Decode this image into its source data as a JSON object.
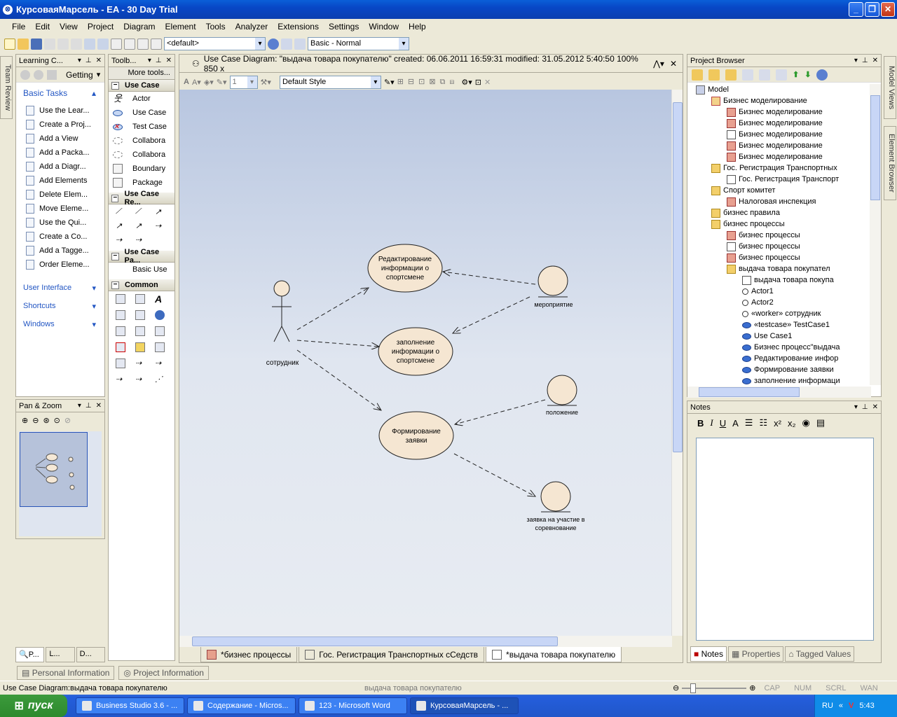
{
  "window": {
    "title": "КурсоваяМарсель - EA - 30 Day Trial"
  },
  "menu": [
    "File",
    "Edit",
    "View",
    "Project",
    "Diagram",
    "Element",
    "Tools",
    "Analyzer",
    "Extensions",
    "Settings",
    "Window",
    "Help"
  ],
  "toolbar": {
    "perspective": "<default>",
    "workspace": "Basic - Normal"
  },
  "side_tabs": {
    "team_review": "Team Review",
    "model_views": "Model Views",
    "element_browser": "Element Browser"
  },
  "learning": {
    "title": "Learning C...",
    "getting": "Getting",
    "basic_tasks": "Basic Tasks",
    "tasks": [
      "Use the Lear...",
      "Create a Proj...",
      "Add a View",
      "Add a Packa...",
      "Add a Diagr...",
      "Add Elements",
      "Delete Elem...",
      "Move Eleme...",
      "Use the Qui...",
      "Create a Co...",
      "Add a Tagge...",
      "Order Eleme..."
    ],
    "sections": [
      "User Interface",
      "Shortcuts",
      "Windows"
    ]
  },
  "panzoom": {
    "title": "Pan & Zoom"
  },
  "left_tabs": [
    "P...",
    "L...",
    "D..."
  ],
  "toolbox": {
    "title": "Toolb...",
    "more": "More tools...",
    "use_case": "Use Case",
    "items": [
      "Actor",
      "Use Case",
      "Test Case",
      "Collabora",
      "Collabora",
      "Boundary",
      "Package"
    ],
    "relations": "Use Case Re...",
    "patterns": "Use Case Pa...",
    "pattern_item": "Basic Use",
    "common": "Common"
  },
  "diagram": {
    "header": "Use Case Diagram: \"выдача товара покупателю\"   created: 06.06.2011 16:59:31  modified: 31.05.2012 5:40:50   100%   850 x",
    "style": "Default Style",
    "line_width": "1",
    "actor": "сотрудник",
    "usecases": [
      "Редактирование информации о спортсмене",
      "заполнение информации о спортсмене",
      "Формирование заявки"
    ],
    "boundaries": [
      "мероприятие",
      "положение",
      "заявка на участие в соревнование"
    ],
    "tabs": [
      "*бизнес процессы",
      "Гос. Регистрация Транспортных сСедств",
      "*выдача товара покупателю"
    ]
  },
  "browser": {
    "title": "Project Browser",
    "tree": [
      {
        "l": 0,
        "t": "Model",
        "i": "model"
      },
      {
        "l": 1,
        "t": "Бизнес моделирование",
        "i": "pkg"
      },
      {
        "l": 2,
        "t": "Бизнес моделирование",
        "i": "diag"
      },
      {
        "l": 2,
        "t": "Бизнес моделирование",
        "i": "diag"
      },
      {
        "l": 2,
        "t": "Бизнес моделирование",
        "i": "uc"
      },
      {
        "l": 2,
        "t": "Бизнес моделирование",
        "i": "diag"
      },
      {
        "l": 2,
        "t": "Бизнес моделирование",
        "i": "diag"
      },
      {
        "l": 1,
        "t": "Гос. Регистрация Транспортных",
        "i": "folder"
      },
      {
        "l": 2,
        "t": "Гос. Регистрация Транспорт",
        "i": "uc"
      },
      {
        "l": 1,
        "t": "Спорт комитет",
        "i": "folder"
      },
      {
        "l": 2,
        "t": "Налоговая инспекция",
        "i": "diag"
      },
      {
        "l": 1,
        "t": "бизнес правила",
        "i": "folder"
      },
      {
        "l": 1,
        "t": "бизнес процессы",
        "i": "folder"
      },
      {
        "l": 2,
        "t": "бизнес процессы",
        "i": "diag"
      },
      {
        "l": 2,
        "t": "бизнес процессы",
        "i": "uc"
      },
      {
        "l": 2,
        "t": "бизнес процессы",
        "i": "diag"
      },
      {
        "l": 2,
        "t": "выдача товара покупател",
        "i": "folder"
      },
      {
        "l": 3,
        "t": "выдача товара покупа",
        "i": "uc"
      },
      {
        "l": 3,
        "t": "Actor1",
        "i": "actor"
      },
      {
        "l": 3,
        "t": "Actor2",
        "i": "actor"
      },
      {
        "l": 3,
        "t": "«worker» сотрудник",
        "i": "actor"
      },
      {
        "l": 3,
        "t": "«testcase» TestCase1",
        "i": "ell"
      },
      {
        "l": 3,
        "t": "Use Case1",
        "i": "ell"
      },
      {
        "l": 3,
        "t": "Бизнес процесс\"выдача",
        "i": "ell"
      },
      {
        "l": 3,
        "t": "Редактирование инфор",
        "i": "ell"
      },
      {
        "l": 3,
        "t": "Формирование заявки",
        "i": "ell"
      },
      {
        "l": 3,
        "t": "заполнение информаци",
        "i": "ell"
      }
    ]
  },
  "notes": {
    "title": "Notes",
    "tabs": [
      "Notes",
      "Properties",
      "Tagged Values"
    ]
  },
  "bottom_tabs": [
    "Personal Information",
    "Project Information"
  ],
  "status": {
    "left": "Use Case Diagram:выдача товара покупателю",
    "center": "выдача товара покупателю",
    "flags": [
      "CAP",
      "NUM",
      "SCRL",
      "WAN"
    ]
  },
  "taskbar": {
    "start": "пуск",
    "tasks": [
      "Business Studio 3.6 - ...",
      "Содержание - Micros...",
      "123 - Microsoft Word",
      "КурсоваяМарсель - ..."
    ],
    "lang": "RU",
    "time": "5:43"
  }
}
